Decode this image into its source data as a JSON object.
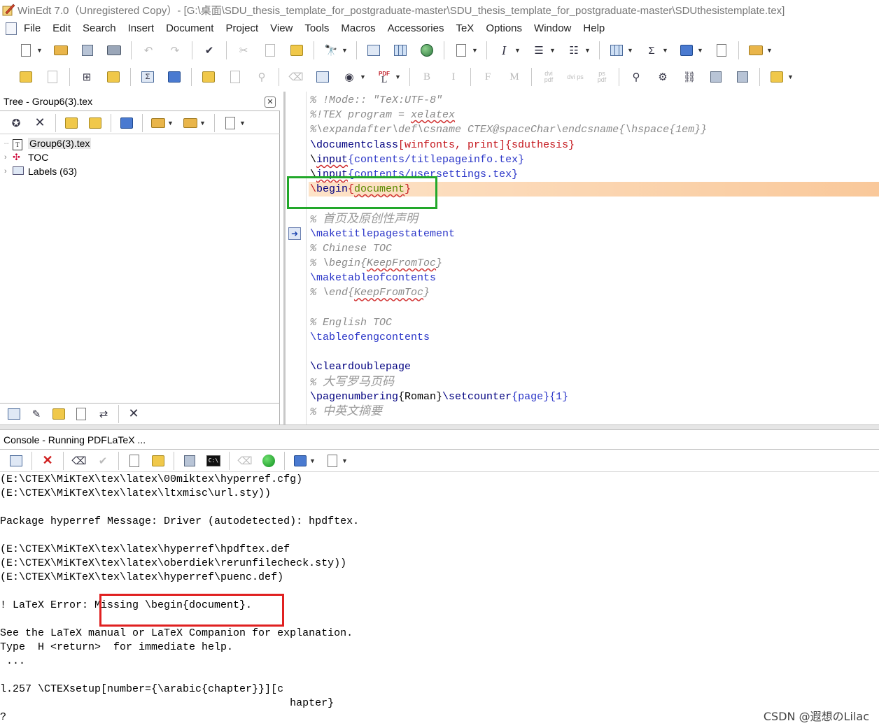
{
  "window": {
    "title": "WinEdt 7.0（Unregistered  Copy）- [G:\\桌面\\SDU_thesis_template_for_postgraduate-master\\SDU_thesis_template_for_postgraduate-master\\SDUthesistemplate.tex]"
  },
  "menu": [
    "File",
    "Edit",
    "Search",
    "Insert",
    "Document",
    "Project",
    "View",
    "Tools",
    "Macros",
    "Accessories",
    "TeX",
    "Options",
    "Window",
    "Help"
  ],
  "toolbar2_labels": {
    "pdf": "PDF",
    "bold": "B",
    "italic": "I",
    "f": "F",
    "m": "M",
    "dvipdf": "dvi pdf",
    "dvips": "dvi ps",
    "pspdf": "ps pdf",
    "sigma": "Σ"
  },
  "tree": {
    "header": "Tree - Group6(3).tex",
    "nodes": [
      {
        "label": "Group6(3).tex",
        "selected": true
      },
      {
        "label": "TOC",
        "selected": false
      },
      {
        "label": "Labels  (63)",
        "selected": false
      }
    ]
  },
  "editor": {
    "lines": [
      {
        "parts": [
          {
            "t": "% !Mode:: \"TeX:UTF-8\"",
            "c": "c-com"
          }
        ]
      },
      {
        "parts": [
          {
            "t": "%!TEX program = ",
            "c": "c-com"
          },
          {
            "t": "xelatex",
            "c": "c-com sq"
          }
        ]
      },
      {
        "parts": [
          {
            "t": "%\\expandafter\\def\\csname CTEX@spaceChar\\endcsname{\\hspace{1em}}",
            "c": "c-com"
          }
        ]
      },
      {
        "parts": [
          {
            "t": "\\documentclass",
            "c": "c-kw"
          },
          {
            "t": "[winfonts, print]{sduthesis}",
            "c": "c-red"
          }
        ]
      },
      {
        "parts": [
          {
            "t": "\\",
            "c": "c-bk"
          },
          {
            "t": "input",
            "c": "c-kw sq"
          },
          {
            "t": "{contents/titlepageinfo.tex}",
            "c": "c-cmd"
          }
        ]
      },
      {
        "parts": [
          {
            "t": "\\",
            "c": "c-bk"
          },
          {
            "t": "input",
            "c": "c-kw sq"
          },
          {
            "t": "{contents/usersettings.tex}",
            "c": "c-cmd"
          }
        ]
      },
      {
        "parts": [
          {
            "t": "\\",
            "c": "c-red"
          },
          {
            "t": "begin",
            "c": "c-kw"
          },
          {
            "t": "{",
            "c": "c-red"
          },
          {
            "t": "document",
            "c": "c-grn sq"
          },
          {
            "t": "}",
            "c": "c-red"
          }
        ],
        "highlight": true
      },
      {
        "parts": [
          {
            "t": "",
            "c": "c-bk"
          }
        ]
      },
      {
        "parts": [
          {
            "t": "% ",
            "c": "c-com"
          },
          {
            "t": "首页及原创性声明",
            "c": "c-cjk"
          }
        ]
      },
      {
        "parts": [
          {
            "t": "\\maketitlepagestatement",
            "c": "c-cmd"
          }
        ]
      },
      {
        "parts": [
          {
            "t": "% Chinese TOC",
            "c": "c-com"
          }
        ]
      },
      {
        "parts": [
          {
            "t": "% \\begin{",
            "c": "c-com"
          },
          {
            "t": "KeepFromToc",
            "c": "c-com sq"
          },
          {
            "t": "}",
            "c": "c-com"
          }
        ]
      },
      {
        "parts": [
          {
            "t": "\\maketableofcontents",
            "c": "c-cmd"
          }
        ]
      },
      {
        "parts": [
          {
            "t": "% \\end{",
            "c": "c-com"
          },
          {
            "t": "KeepFromToc",
            "c": "c-com sq"
          },
          {
            "t": "}",
            "c": "c-com"
          }
        ]
      },
      {
        "parts": [
          {
            "t": "",
            "c": "c-bk"
          }
        ]
      },
      {
        "parts": [
          {
            "t": "% English TOC",
            "c": "c-com"
          }
        ]
      },
      {
        "parts": [
          {
            "t": "\\tableofengcontents",
            "c": "c-cmd"
          }
        ]
      },
      {
        "parts": [
          {
            "t": "",
            "c": "c-bk"
          }
        ]
      },
      {
        "parts": [
          {
            "t": "\\cleardoublepage",
            "c": "c-kw"
          }
        ]
      },
      {
        "parts": [
          {
            "t": "% ",
            "c": "c-com"
          },
          {
            "t": "大写罗马页码",
            "c": "c-cjk"
          }
        ]
      },
      {
        "parts": [
          {
            "t": "\\pagenumbering",
            "c": "c-kw"
          },
          {
            "t": "{Roman}",
            "c": "c-bk"
          },
          {
            "t": "\\setcounter",
            "c": "c-kw"
          },
          {
            "t": "{page}{1}",
            "c": "c-cmd"
          }
        ]
      },
      {
        "parts": [
          {
            "t": "% ",
            "c": "c-com"
          },
          {
            "t": "中英文摘要",
            "c": "c-cjk"
          }
        ]
      }
    ]
  },
  "console": {
    "header": "Console - Running PDFLaTeX ...",
    "lines": [
      "(E:\\CTEX\\MiKTeX\\tex\\latex\\00miktex\\hyperref.cfg)",
      "(E:\\CTEX\\MiKTeX\\tex\\latex\\ltxmisc\\url.sty))",
      "",
      "Package hyperref Message: Driver (autodetected): hpdftex.",
      "",
      "(E:\\CTEX\\MiKTeX\\tex\\latex\\hyperref\\hpdftex.def",
      "(E:\\CTEX\\MiKTeX\\tex\\latex\\oberdiek\\rerunfilecheck.sty))",
      "(E:\\CTEX\\MiKTeX\\tex\\latex\\hyperref\\puenc.def)",
      "",
      "! LaTeX Error: Missing \\begin{document}.",
      "",
      "See the LaTeX manual or LaTeX Companion for explanation.",
      "Type  H <return>  for immediate help.",
      " ...",
      "",
      "l.257 \\CTEXsetup[number={\\arabic{chapter}}][c",
      "                                              hapter}",
      "?"
    ]
  },
  "watermark": "CSDN @遐想のLilac"
}
